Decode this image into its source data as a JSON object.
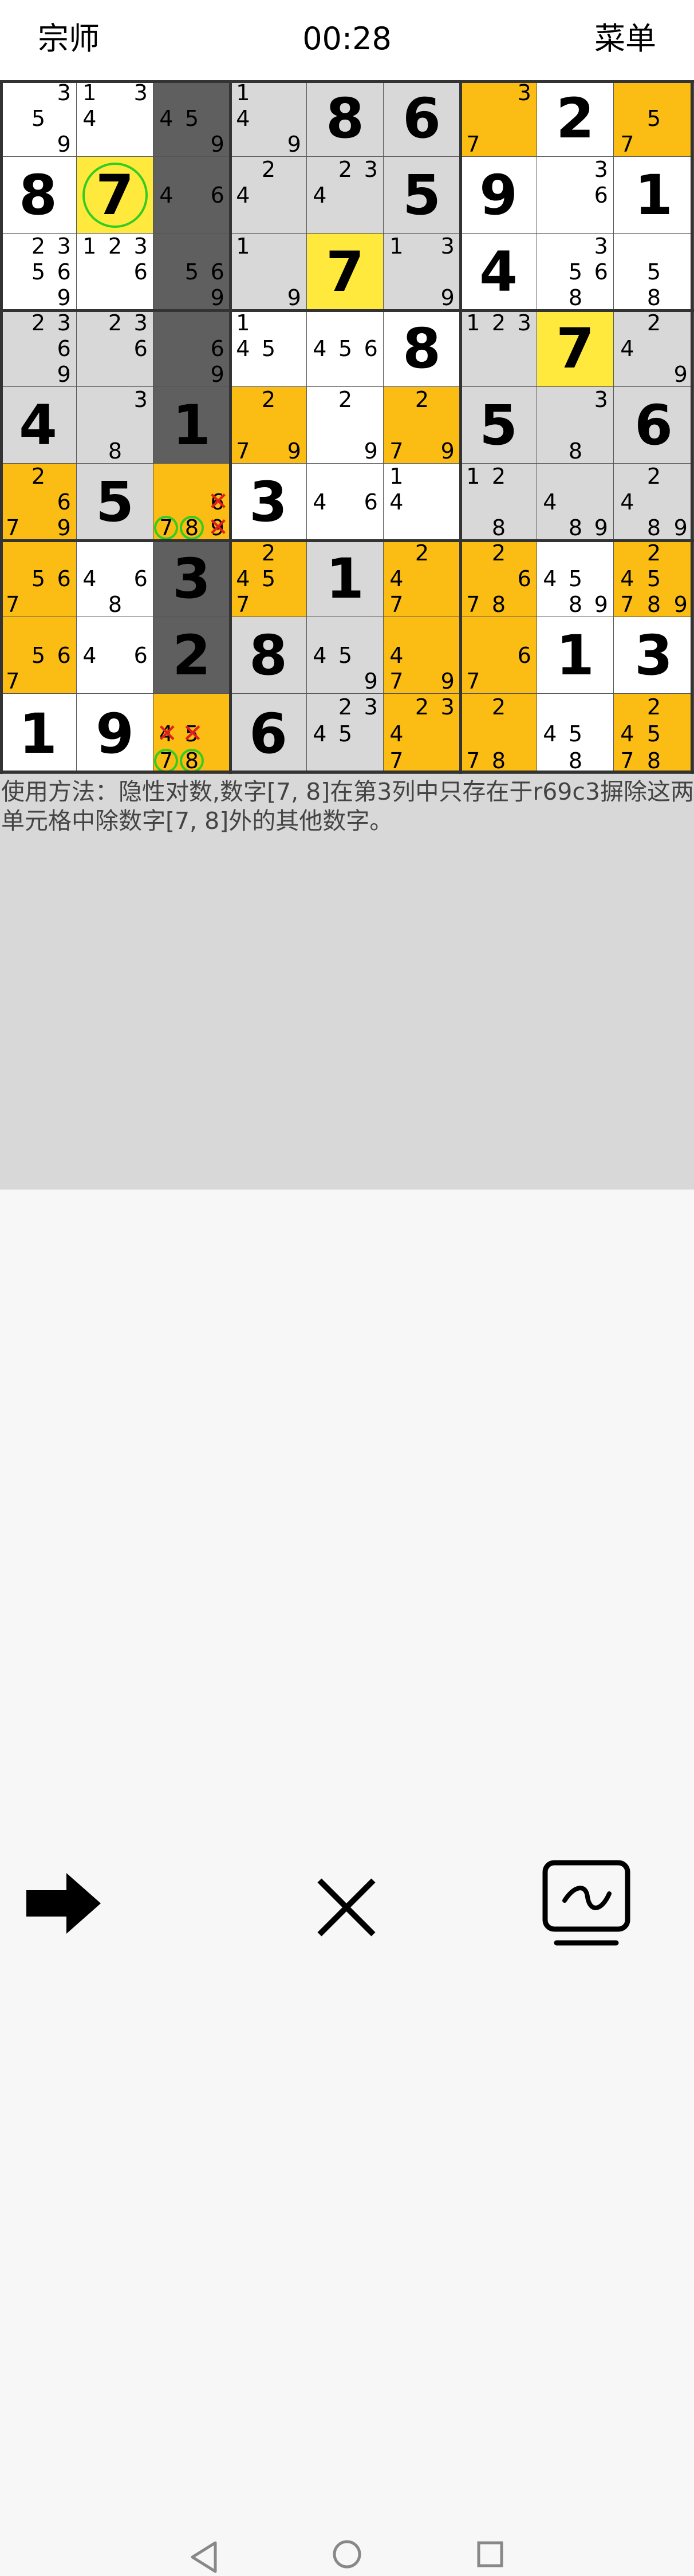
{
  "header": {
    "level": "宗师",
    "timer": "00:28",
    "menu": "菜单"
  },
  "colors": {
    "white": "#ffffff",
    "gray": "#d8d8d8",
    "dark": "#5f5f5f",
    "orange": "#fbbd13",
    "yellow": "#ffe93d",
    "ring": "#33cc22",
    "cross": "#e02020"
  },
  "board": {
    "cells": [
      [
        {
          "bg": "white",
          "c": [
            3,
            5,
            9
          ]
        },
        {
          "bg": "white",
          "c": [
            1,
            3,
            4
          ]
        },
        {
          "bg": "dark",
          "c": [
            4,
            5,
            9
          ]
        },
        {
          "bg": "gray",
          "c": [
            1,
            4,
            9
          ]
        },
        {
          "bg": "gray",
          "v": "8"
        },
        {
          "bg": "gray",
          "v": "6"
        },
        {
          "bg": "orange",
          "c": [
            3,
            7
          ]
        },
        {
          "bg": "white",
          "v": "2"
        },
        {
          "bg": "orange",
          "c": [
            5,
            7
          ]
        }
      ],
      [
        {
          "bg": "white",
          "v": "8"
        },
        {
          "bg": "yellow",
          "v": "7",
          "ring": true
        },
        {
          "bg": "dark",
          "c": [
            4,
            6
          ]
        },
        {
          "bg": "gray",
          "c": [
            2,
            4
          ]
        },
        {
          "bg": "gray",
          "c": [
            2,
            3,
            4
          ]
        },
        {
          "bg": "gray",
          "v": "5"
        },
        {
          "bg": "white",
          "v": "9"
        },
        {
          "bg": "white",
          "c": [
            3,
            6
          ]
        },
        {
          "bg": "white",
          "v": "1"
        }
      ],
      [
        {
          "bg": "white",
          "c": [
            2,
            3,
            5,
            6,
            9
          ]
        },
        {
          "bg": "white",
          "c": [
            1,
            2,
            3,
            6
          ]
        },
        {
          "bg": "dark",
          "c": [
            5,
            6,
            9
          ]
        },
        {
          "bg": "gray",
          "c": [
            1,
            9
          ]
        },
        {
          "bg": "yellow",
          "v": "7"
        },
        {
          "bg": "gray",
          "c": [
            1,
            3,
            9
          ]
        },
        {
          "bg": "white",
          "v": "4"
        },
        {
          "bg": "white",
          "c": [
            3,
            5,
            6,
            8
          ]
        },
        {
          "bg": "white",
          "c": [
            5,
            8
          ]
        }
      ],
      [
        {
          "bg": "gray",
          "c": [
            2,
            3,
            6,
            9
          ]
        },
        {
          "bg": "gray",
          "c": [
            2,
            3,
            6
          ]
        },
        {
          "bg": "dark",
          "c": [
            6,
            9
          ]
        },
        {
          "bg": "white",
          "c": [
            1,
            4,
            5
          ]
        },
        {
          "bg": "white",
          "c": [
            4,
            5,
            6
          ]
        },
        {
          "bg": "white",
          "v": "8"
        },
        {
          "bg": "gray",
          "c": [
            1,
            2,
            3
          ]
        },
        {
          "bg": "yellow",
          "v": "7"
        },
        {
          "bg": "gray",
          "c": [
            2,
            4,
            9
          ]
        }
      ],
      [
        {
          "bg": "gray",
          "v": "4"
        },
        {
          "bg": "gray",
          "c": [
            3,
            8
          ]
        },
        {
          "bg": "dark",
          "v": "1"
        },
        {
          "bg": "orange",
          "c": [
            2,
            7,
            9
          ]
        },
        {
          "bg": "white",
          "c": [
            2,
            9
          ]
        },
        {
          "bg": "orange",
          "c": [
            2,
            7,
            9
          ]
        },
        {
          "bg": "gray",
          "v": "5"
        },
        {
          "bg": "gray",
          "c": [
            3,
            8
          ]
        },
        {
          "bg": "gray",
          "v": "6"
        }
      ],
      [
        {
          "bg": "orange",
          "c": [
            2,
            6,
            7,
            9
          ]
        },
        {
          "bg": "gray",
          "v": "5"
        },
        {
          "bg": "orange",
          "c": [
            6,
            7,
            8,
            9
          ],
          "ringc": [
            7,
            8
          ],
          "xc": [
            6,
            9
          ]
        },
        {
          "bg": "white",
          "v": "3"
        },
        {
          "bg": "white",
          "c": [
            4,
            6
          ]
        },
        {
          "bg": "white",
          "c": [
            1,
            4
          ]
        },
        {
          "bg": "gray",
          "c": [
            1,
            2,
            8
          ]
        },
        {
          "bg": "gray",
          "c": [
            4,
            8,
            9
          ]
        },
        {
          "bg": "gray",
          "c": [
            2,
            4,
            8,
            9
          ]
        }
      ],
      [
        {
          "bg": "orange",
          "c": [
            5,
            6,
            7
          ]
        },
        {
          "bg": "white",
          "c": [
            4,
            6,
            8
          ]
        },
        {
          "bg": "dark",
          "v": "3"
        },
        {
          "bg": "orange",
          "c": [
            2,
            4,
            5,
            7
          ]
        },
        {
          "bg": "gray",
          "v": "1"
        },
        {
          "bg": "orange",
          "c": [
            2,
            4,
            7
          ]
        },
        {
          "bg": "orange",
          "c": [
            2,
            6,
            7,
            8
          ]
        },
        {
          "bg": "white",
          "c": [
            4,
            5,
            8,
            9
          ]
        },
        {
          "bg": "orange",
          "c": [
            2,
            4,
            5,
            7,
            8,
            9
          ]
        }
      ],
      [
        {
          "bg": "orange",
          "c": [
            5,
            6,
            7
          ]
        },
        {
          "bg": "white",
          "c": [
            4,
            6
          ]
        },
        {
          "bg": "dark",
          "v": "2"
        },
        {
          "bg": "gray",
          "v": "8"
        },
        {
          "bg": "gray",
          "c": [
            4,
            5,
            9
          ]
        },
        {
          "bg": "orange",
          "c": [
            4,
            7,
            9
          ]
        },
        {
          "bg": "orange",
          "c": [
            6,
            7
          ]
        },
        {
          "bg": "white",
          "v": "1"
        },
        {
          "bg": "white",
          "v": "3"
        }
      ],
      [
        {
          "bg": "white",
          "v": "1"
        },
        {
          "bg": "white",
          "v": "9"
        },
        {
          "bg": "orange",
          "c": [
            4,
            5,
            7,
            8
          ],
          "ringc": [
            7,
            8
          ],
          "xc": [
            4,
            5
          ]
        },
        {
          "bg": "gray",
          "v": "6"
        },
        {
          "bg": "gray",
          "c": [
            2,
            3,
            4,
            5
          ]
        },
        {
          "bg": "orange",
          "c": [
            2,
            3,
            4,
            7
          ]
        },
        {
          "bg": "orange",
          "c": [
            2,
            7,
            8
          ]
        },
        {
          "bg": "white",
          "c": [
            4,
            5,
            8
          ]
        },
        {
          "bg": "orange",
          "c": [
            2,
            4,
            5,
            7,
            8
          ]
        }
      ]
    ]
  },
  "hint": {
    "text": "使用方法：隐性对数,数字[7, 8]在第3列中只存在于r69c3摒除这两单元格中除数字[7, 8]外的其他数字。"
  },
  "controls": {
    "next": "arrow-right-icon",
    "close": "close-icon",
    "chart": "chart-icon"
  }
}
